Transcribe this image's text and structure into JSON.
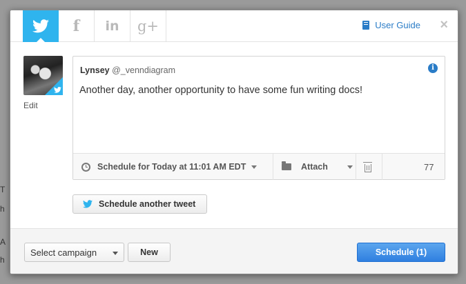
{
  "colors": {
    "twitter_blue": "#2fb4ee",
    "link_blue": "#2a7cc7",
    "primary_button": "#2f7fe0"
  },
  "tabs": [
    {
      "network": "twitter",
      "icon": "twitter-bird-icon",
      "active": true
    },
    {
      "network": "facebook",
      "icon": "facebook-icon",
      "glyph": "f",
      "active": false
    },
    {
      "network": "linkedin",
      "icon": "linkedin-icon",
      "glyph": "in",
      "active": false
    },
    {
      "network": "google-plus",
      "icon": "google-plus-icon",
      "glyph": "g+",
      "active": false
    }
  ],
  "header": {
    "user_guide_label": "User Guide",
    "user_guide_icon": "book-icon",
    "close_icon": "close-icon",
    "close_glyph": "×"
  },
  "profile": {
    "edit_label": "Edit"
  },
  "composer": {
    "name": "Lynsey",
    "handle": "@_venndiagram",
    "info_glyph": "i",
    "text": "Another day, another opportunity to have some fun writing docs!",
    "schedule_label": "Schedule for Today at 11:01 AM EDT",
    "attach_label": "Attach",
    "char_count": "77"
  },
  "schedule_another_label": "Schedule another tweet",
  "footer": {
    "campaign_selected": "Select campaign",
    "new_label": "New",
    "schedule_button_label": "Schedule (1)"
  },
  "background": {
    "fragments": [
      "T",
      "h",
      "A",
      "h"
    ]
  }
}
